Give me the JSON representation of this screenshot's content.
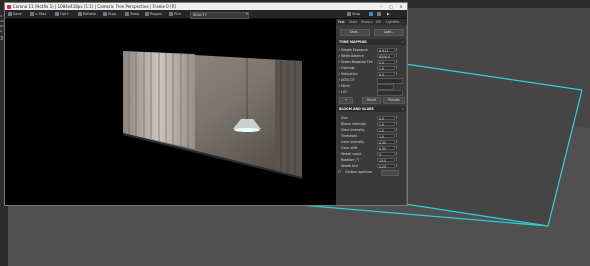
{
  "window": {
    "title": "Corona 11 (Hotfix 1) | 1084x418px (1:1) | Camera: Free Perspective | Frame 0 [R]"
  },
  "left_strip": [
    "X:",
    "4a:",
    "Pos:",
    "Z:",
    "3"
  ],
  "toolbar": {
    "items": [
      "Save",
      "> Max",
      "Opt+",
      "Refresh",
      "Stop",
      "Tasks",
      "Region",
      "Pick"
    ],
    "beauty": "BEAUTY",
    "right_items": [
      "Stop"
    ]
  },
  "tabs": [
    "Post",
    "Stats",
    "History",
    "DR",
    "LightMix"
  ],
  "panel_buttons": {
    "save": "Save...",
    "load": "Load..."
  },
  "tone_mapping": {
    "title": "TONE MAPPING",
    "rows": [
      {
        "label": "Simple Exposure",
        "value": "0.917",
        "checked": true
      },
      {
        "label": "White Balance",
        "value": "6500.0",
        "checked": true
      },
      {
        "label": "Green-Magenta Tint",
        "value": "0.0",
        "checked": true
      },
      {
        "label": "Contrast",
        "value": "1.0",
        "checked": true
      },
      {
        "label": "Saturation",
        "value": "0.0",
        "checked": true
      },
      {
        "label": "ACES OT",
        "value": "",
        "checked": true
      },
      {
        "label": "Filmic",
        "value": "",
        "checked": true
      },
      {
        "label": "LUT",
        "value": "",
        "checked": true
      }
    ],
    "reset": "Reset",
    "presets": "Presets"
  },
  "bloom_glare": {
    "title": "BLOOM AND GLARE",
    "rows": [
      {
        "label": "Size",
        "value": "0.0"
      },
      {
        "label": "Bloom intensity",
        "value": "1.0"
      },
      {
        "label": "Glare intensity",
        "value": "1.0"
      },
      {
        "label": "Threshold",
        "value": "1.0"
      },
      {
        "label": "Color intensity",
        "value": "0.30"
      },
      {
        "label": "Color shift",
        "value": "0.50"
      },
      {
        "label": "Streak count",
        "value": "3"
      },
      {
        "label": "Rotation (°)",
        "value": "15.0"
      },
      {
        "label": "Streak blur",
        "value": "0.20"
      }
    ],
    "custom_aperture": "Custom aperture"
  },
  "colors": {
    "accent_outline": "#28d4d8",
    "panel_bg": "#3a3a3a",
    "check": "#7fd"
  }
}
